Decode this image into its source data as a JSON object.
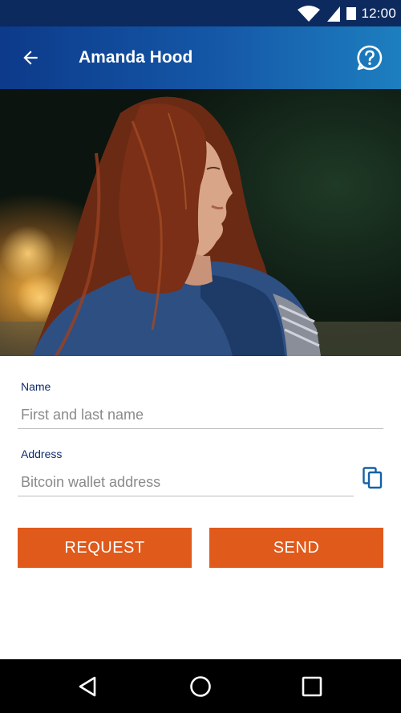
{
  "status_bar": {
    "time": "12:00",
    "icons": [
      "wifi-icon",
      "signal-icon",
      "battery-icon"
    ]
  },
  "app_bar": {
    "title": "Amanda Hood",
    "back_icon": "arrow-back-icon",
    "help_icon": "help-icon"
  },
  "form": {
    "name_label": "Name",
    "name_placeholder": "First and last name",
    "name_value": "",
    "address_label": "Address",
    "address_placeholder": "Bitcoin wallet address",
    "address_value": "",
    "copy_icon": "copy-icon"
  },
  "actions": {
    "request_label": "REQUEST",
    "send_label": "SEND"
  },
  "nav_bar": {
    "icons": [
      "back-triangle-icon",
      "home-circle-icon",
      "recents-square-icon"
    ]
  },
  "colors": {
    "accent": "#e05a1c",
    "app_bar_start": "#0d3a8a",
    "app_bar_end": "#1d7fbf",
    "label": "#102b6a"
  }
}
